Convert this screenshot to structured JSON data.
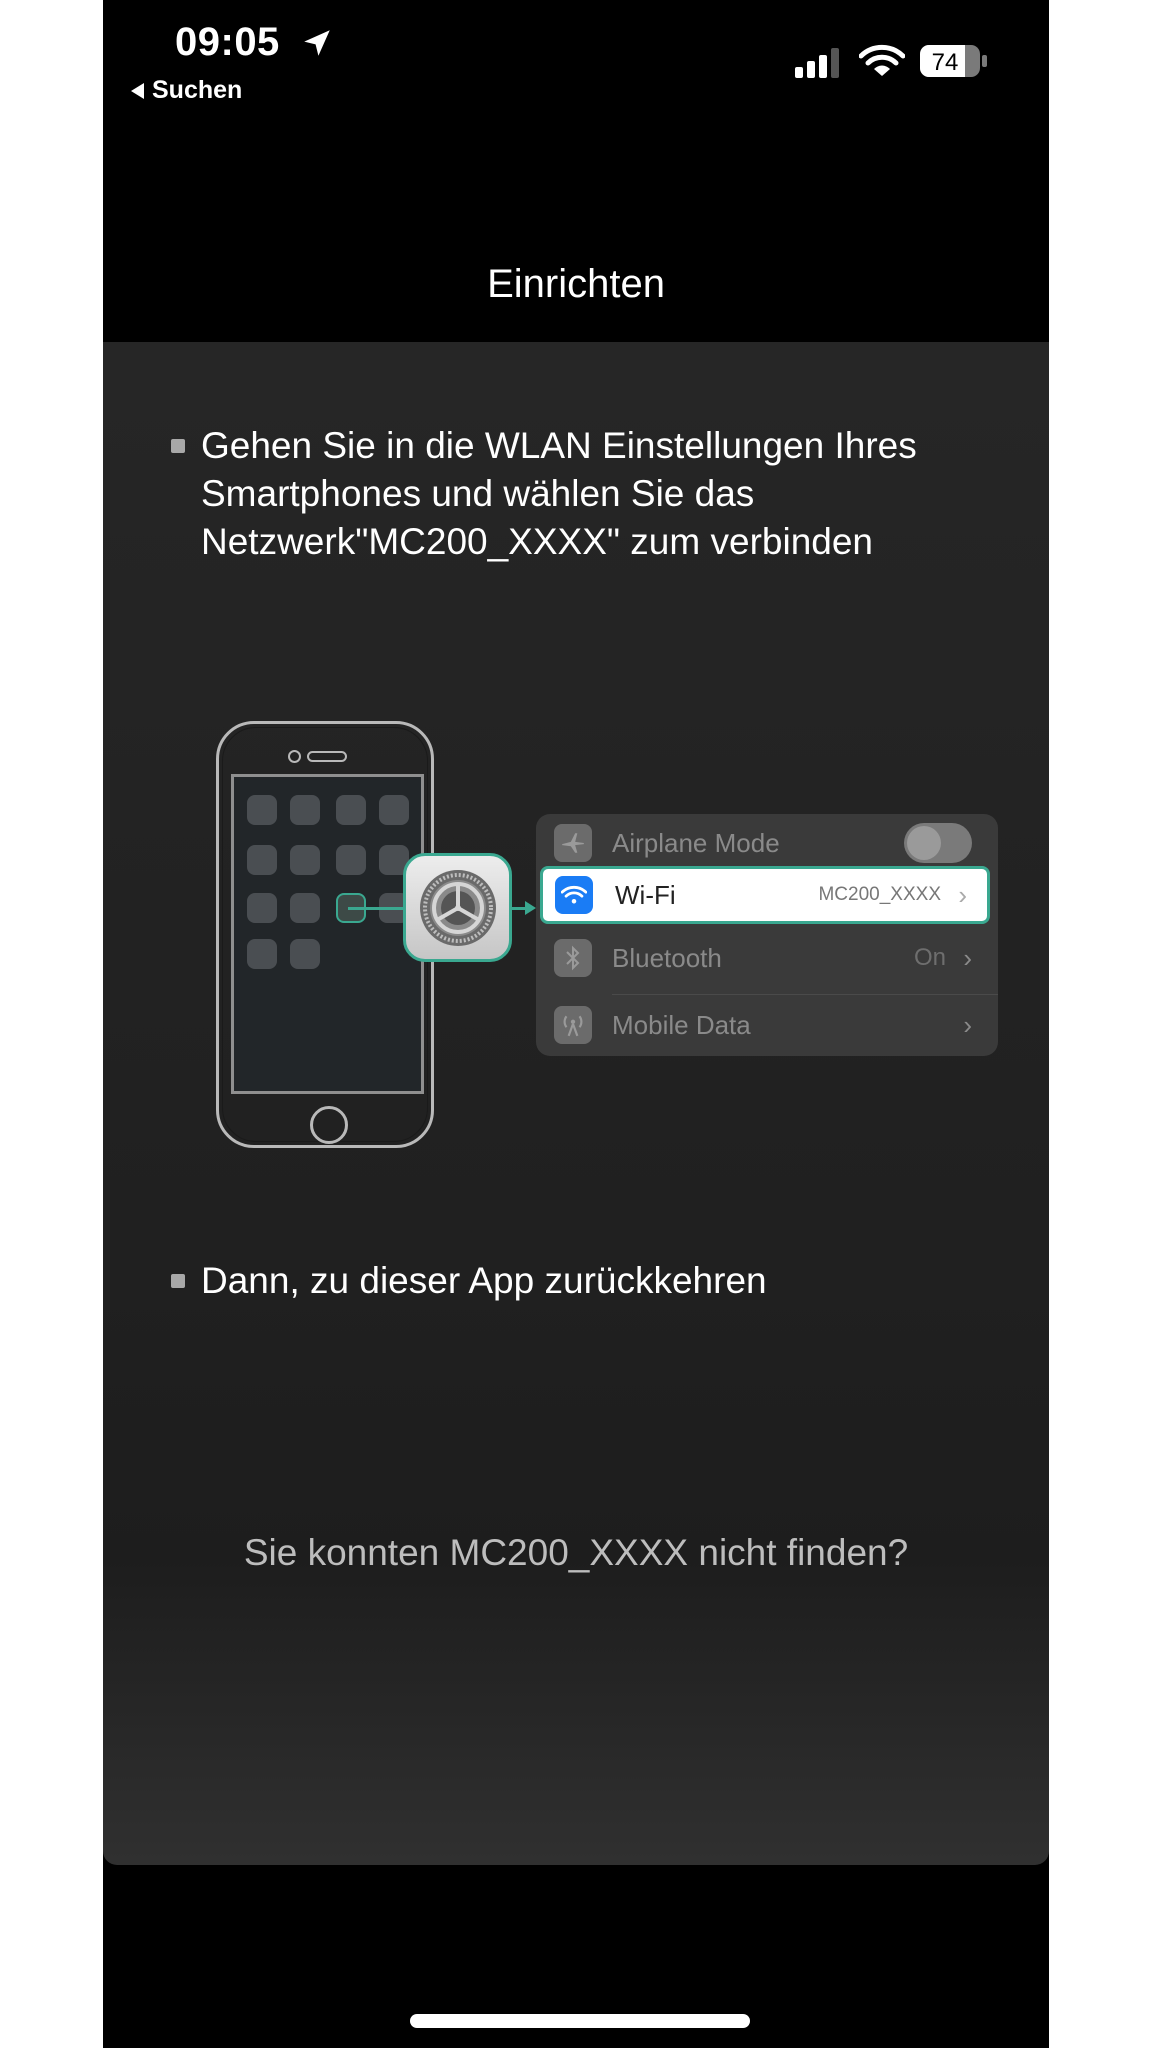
{
  "status_bar": {
    "time": "09:05",
    "location_icon": "location-arrow-icon",
    "back_label": "Suchen",
    "signal_bars_active": 3,
    "signal_bars_total": 4,
    "battery_percent": "74"
  },
  "header": {
    "title": "Einrichten"
  },
  "instructions": {
    "step1": "Gehen Sie in die WLAN Einstellungen Ihres Smartphones und wählen Sie das Netzwerk\"MC200_XXXX\" zum verbinden",
    "step2": "Dann, zu dieser App zurückkehren"
  },
  "illustration": {
    "settings_rows": [
      {
        "label": "Airplane Mode",
        "value": "",
        "icon": "airplane-icon",
        "control": "toggle-off"
      },
      {
        "label": "Wi-Fi",
        "value": "MC200_XXXX",
        "icon": "wifi-icon",
        "highlighted": true
      },
      {
        "label": "Bluetooth",
        "value": "On",
        "icon": "bluetooth-icon"
      },
      {
        "label": "Mobile Data",
        "value": "",
        "icon": "antenna-icon"
      }
    ],
    "accent_color": "#3aa890",
    "wifi_icon_color": "#1a7cf5"
  },
  "help_link": "Sie konnten MC200_XXXX nicht finden?"
}
